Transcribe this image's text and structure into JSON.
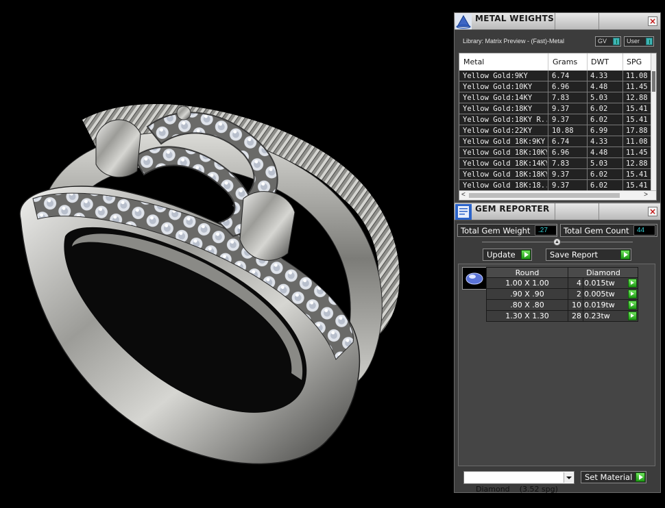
{
  "metal_weights": {
    "title": "METAL WEIGHTS",
    "library_label": "Library: Matrix Preview - (Fast)-Metal",
    "toggle_gv": "GV",
    "toggle_user": "User",
    "close": "×",
    "columns": [
      "Metal",
      "Grams",
      "DWT",
      "SPG"
    ],
    "rows": [
      [
        "Yellow Gold:9KY",
        "6.74",
        "4.33",
        "11.08"
      ],
      [
        "Yellow Gold:10KY",
        "6.96",
        "4.48",
        "11.45"
      ],
      [
        "Yellow Gold:14KY",
        "7.83",
        "5.03",
        "12.88"
      ],
      [
        "Yellow Gold:18KY",
        "9.37",
        "6.02",
        "15.41"
      ],
      [
        "Yellow Gold:18KY R...",
        "9.37",
        "6.02",
        "15.41"
      ],
      [
        "Yellow Gold:22KY",
        "10.88",
        "6.99",
        "17.88"
      ],
      [
        "Yellow Gold 18K:9KY",
        "6.74",
        "4.33",
        "11.08"
      ],
      [
        "Yellow Gold 18K:10KY",
        "6.96",
        "4.48",
        "11.45"
      ],
      [
        "Yellow Gold 18K:14KY",
        "7.83",
        "5.03",
        "12.88"
      ],
      [
        "Yellow Gold 18K:18KY",
        "9.37",
        "6.02",
        "15.41"
      ],
      [
        "Yellow Gold 18K:18...",
        "9.37",
        "6.02",
        "15.41"
      ]
    ],
    "scroll_left": "<",
    "scroll_right": ">"
  },
  "gem_reporter": {
    "title": "GEM REPORTER",
    "close": "×",
    "total_weight_label": "Total Gem Weight",
    "total_weight_value": ".27",
    "total_count_label": "Total Gem Count",
    "total_count_value": "44",
    "update_label": "Update",
    "save_report_label": "Save Report",
    "table": {
      "header_shape": "Round",
      "header_material": "Diamond",
      "rows": [
        {
          "size": "1.00 X 1.00",
          "count": "4",
          "weight": "0.015tw"
        },
        {
          "size": ".90 X .90",
          "count": "2",
          "weight": "0.005tw"
        },
        {
          "size": ".80 X .80",
          "count": "10",
          "weight": "0.019tw"
        },
        {
          "size": "1.30 X 1.30",
          "count": "28",
          "weight": "0.23tw"
        }
      ]
    },
    "material_select": "Diamond    (3.52 spg)",
    "set_material_label": "Set Material"
  },
  "colors": {
    "accent_value": "#34cfd4",
    "play_green": "#2fb424",
    "close_red": "#c31414"
  }
}
